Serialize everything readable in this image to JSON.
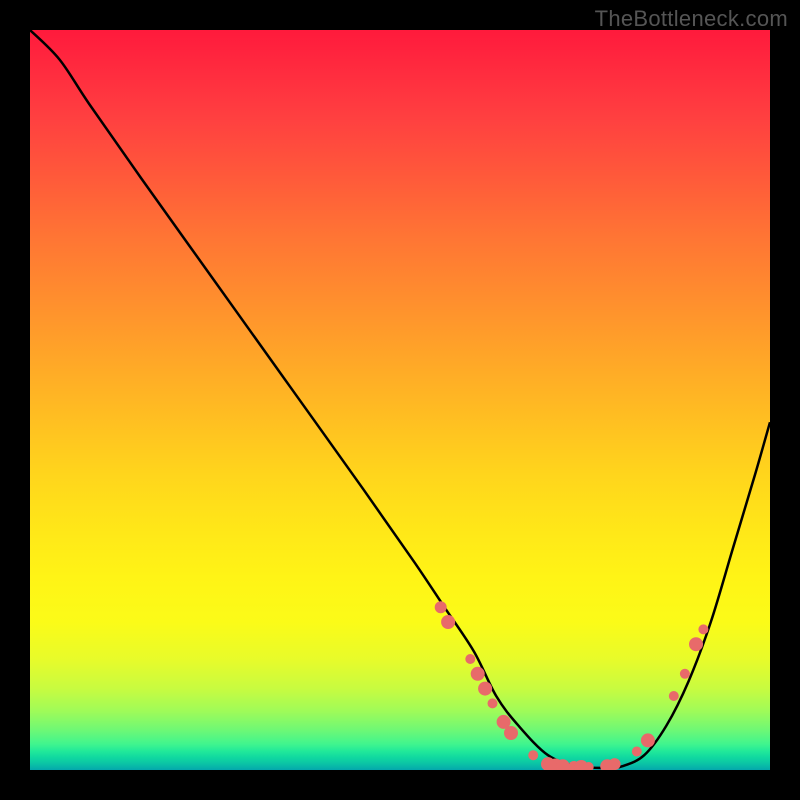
{
  "watermark": "TheBottleneck.com",
  "chart_data": {
    "type": "line",
    "title": "",
    "xlabel": "",
    "ylabel": "",
    "xlim": [
      0,
      100
    ],
    "ylim": [
      0,
      100
    ],
    "curve": {
      "x": [
        0,
        4,
        8,
        15,
        25,
        35,
        45,
        52,
        56,
        60,
        63,
        66,
        70,
        74,
        78,
        80,
        83,
        86,
        89,
        92,
        95,
        98,
        100
      ],
      "y": [
        100,
        96,
        90,
        80,
        66,
        52,
        38,
        28,
        22,
        16,
        10,
        6,
        2,
        0.5,
        0.3,
        0.5,
        2,
        6,
        12,
        20,
        30,
        40,
        47
      ]
    },
    "markers": [
      {
        "x": 55.5,
        "y": 22,
        "r": 6
      },
      {
        "x": 56.5,
        "y": 20,
        "r": 7
      },
      {
        "x": 59.5,
        "y": 15,
        "r": 5
      },
      {
        "x": 60.5,
        "y": 13,
        "r": 7
      },
      {
        "x": 61.5,
        "y": 11,
        "r": 7
      },
      {
        "x": 62.5,
        "y": 9,
        "r": 5
      },
      {
        "x": 64,
        "y": 6.5,
        "r": 7
      },
      {
        "x": 65,
        "y": 5,
        "r": 7
      },
      {
        "x": 68,
        "y": 2,
        "r": 5
      },
      {
        "x": 70,
        "y": 0.8,
        "r": 7
      },
      {
        "x": 71,
        "y": 0.6,
        "r": 7
      },
      {
        "x": 72,
        "y": 0.5,
        "r": 7
      },
      {
        "x": 73.5,
        "y": 0.4,
        "r": 6
      },
      {
        "x": 74.5,
        "y": 0.4,
        "r": 7
      },
      {
        "x": 75.5,
        "y": 0.4,
        "r": 5
      },
      {
        "x": 78,
        "y": 0.5,
        "r": 7
      },
      {
        "x": 79,
        "y": 0.8,
        "r": 6
      },
      {
        "x": 82,
        "y": 2.5,
        "r": 5
      },
      {
        "x": 83.5,
        "y": 4,
        "r": 7
      },
      {
        "x": 87,
        "y": 10,
        "r": 5
      },
      {
        "x": 88.5,
        "y": 13,
        "r": 5
      },
      {
        "x": 90,
        "y": 17,
        "r": 7
      },
      {
        "x": 91,
        "y": 19,
        "r": 5
      }
    ],
    "gradient_stops": [
      {
        "offset": 0,
        "color": "#ff1a3c"
      },
      {
        "offset": 50,
        "color": "#ffc020"
      },
      {
        "offset": 80,
        "color": "#fbfb18"
      },
      {
        "offset": 96,
        "color": "#40f58e"
      },
      {
        "offset": 100,
        "color": "#04a8ac"
      }
    ]
  }
}
